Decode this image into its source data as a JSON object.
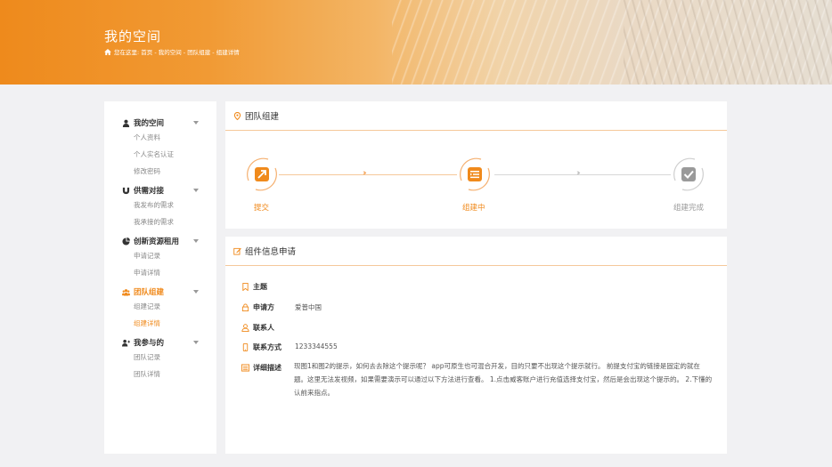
{
  "banner": {
    "title": "我的空间",
    "breadcrumb": "您在这里: 首页 - 我的空间 - 团队组建 - 组建详情"
  },
  "sidebar": {
    "groups": [
      {
        "label": "我的空间",
        "icon": "user-icon",
        "items": [
          "个人资料",
          "个人实名认证",
          "修改密码"
        ]
      },
      {
        "label": "供需对接",
        "icon": "magnet-icon",
        "items": [
          "我发布的需求",
          "我承接的需求"
        ]
      },
      {
        "label": "创新资源租用",
        "icon": "pie-chart-icon",
        "items": [
          "申请记录",
          "申请详情"
        ]
      },
      {
        "label": "团队组建",
        "icon": "team-icon",
        "items": [
          "组建记录",
          "组建详情"
        ],
        "active": true,
        "active_item": 1
      },
      {
        "label": "我参与的",
        "icon": "users-icon",
        "items": [
          "团队记录",
          "团队详情"
        ]
      }
    ]
  },
  "team_panel": {
    "title": "团队组建",
    "steps": [
      {
        "label": "提交",
        "icon": "external-link-icon",
        "state": "done"
      },
      {
        "label": "组建中",
        "icon": "list-icon",
        "state": "current"
      },
      {
        "label": "组建完成",
        "icon": "check-square-icon",
        "state": "pending"
      }
    ]
  },
  "info_panel": {
    "title": "组件信息申请",
    "fields": [
      {
        "label": "主题",
        "value": "",
        "icon": "bookmark-icon"
      },
      {
        "label": "申请方",
        "value": "爱普中国",
        "icon": "lock-icon"
      },
      {
        "label": "联系人",
        "value": "",
        "icon": "user-outline-icon"
      },
      {
        "label": "联系方式",
        "value": "1233344555",
        "icon": "phone-icon"
      },
      {
        "label": "详细描述",
        "value": "",
        "icon": "list-alt-icon"
      }
    ],
    "description": "现图1和图2的提示，如何去去除这个提示呢？ app可原生也可混合开发，目的只要不出现这个提示就行。 前提支付宝的链接是固定的就在题。这里无法发视频，如果需要演示可以通过以下方法进行查看。 1.点击威客账户进行充值选择支付宝，然后是会出现这个提示的。 2.下懂的认前来指点。"
  },
  "colors": {
    "accent": "#f08a1c",
    "accent_light": "#f5c89a"
  }
}
